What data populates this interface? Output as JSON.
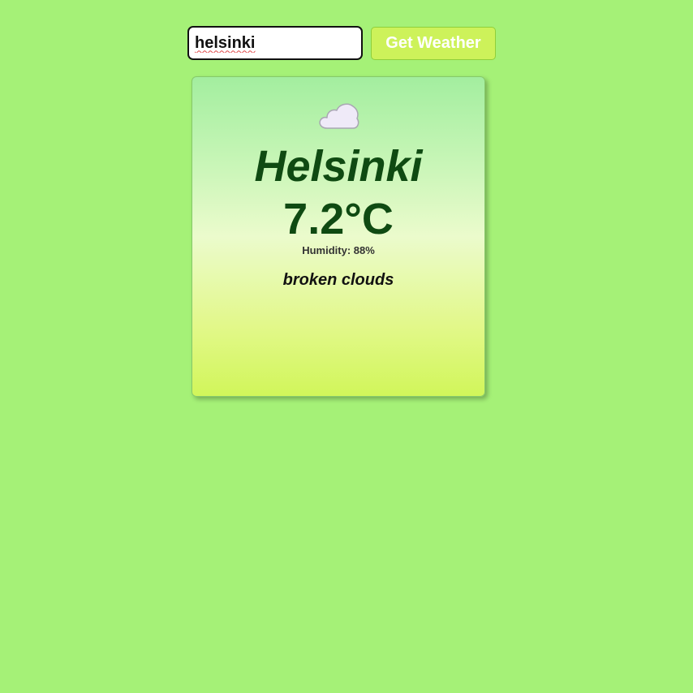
{
  "search": {
    "value": "helsinki",
    "button_label": "Get Weather"
  },
  "weather": {
    "icon": "cloud-icon",
    "city": "Helsinki",
    "temperature": "7.2°C",
    "humidity": "Humidity: 88%",
    "description": "broken clouds"
  },
  "colors": {
    "background": "#a5f177",
    "button": "#cdf25a",
    "city_text": "#0f4a12"
  }
}
